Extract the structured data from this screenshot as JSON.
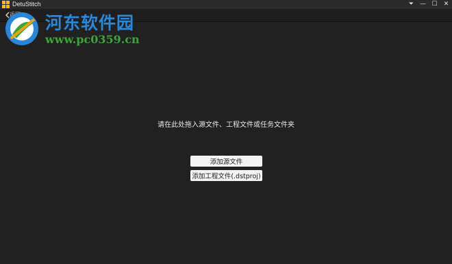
{
  "window": {
    "title": "DetuStitch",
    "controls": {
      "menu_glyph": "⏷",
      "minimize_glyph": "—",
      "maximize_glyph": "☐",
      "close_glyph": "✕"
    }
  },
  "toolbar": {
    "back_icon": "back-arrow-icon",
    "back_label": "返回"
  },
  "watermark": {
    "name": "河东软件园",
    "url": "www.pc0359.cn"
  },
  "main": {
    "drop_hint": "请在此处拖入源文件、工程文件或任务文件夹",
    "add_source_button": "添加源文件",
    "add_project_button": "添加工程文件(.dstproj)"
  },
  "colors": {
    "background": "#212121",
    "titlebar": "#2b2b2b",
    "app_icon": "#f2c200",
    "button_bg": "#f4f4f4",
    "watermark_blue": "#2a86d8",
    "watermark_green": "#3da33a"
  }
}
